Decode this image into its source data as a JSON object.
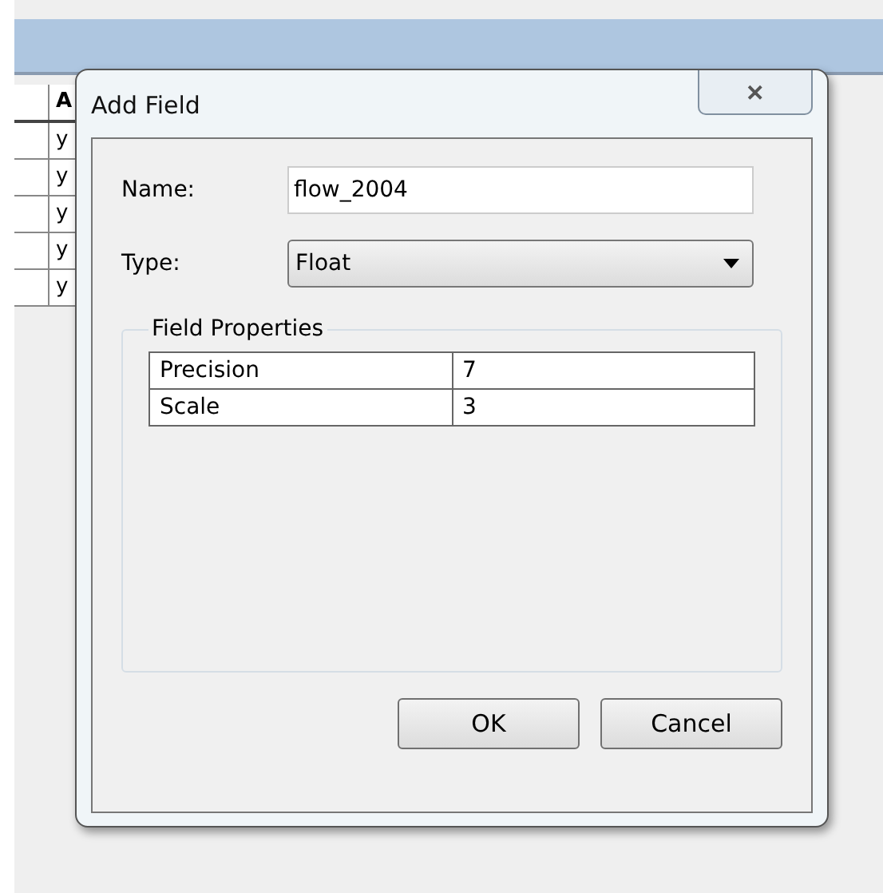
{
  "background_table": {
    "column_2_header": "A",
    "rows": [
      "y",
      "y",
      "y",
      "y",
      "y"
    ]
  },
  "dialog": {
    "title": "Add Field",
    "close": "✕",
    "name": {
      "label": "Name:",
      "value": "flow_2004"
    },
    "type": {
      "label": "Type:",
      "value": "Float"
    },
    "properties": {
      "title": "Field Properties",
      "rows": [
        {
          "name": "Precision",
          "value": "7"
        },
        {
          "name": "Scale",
          "value": "3"
        }
      ]
    },
    "buttons": [
      "OK",
      "Cancel"
    ]
  }
}
